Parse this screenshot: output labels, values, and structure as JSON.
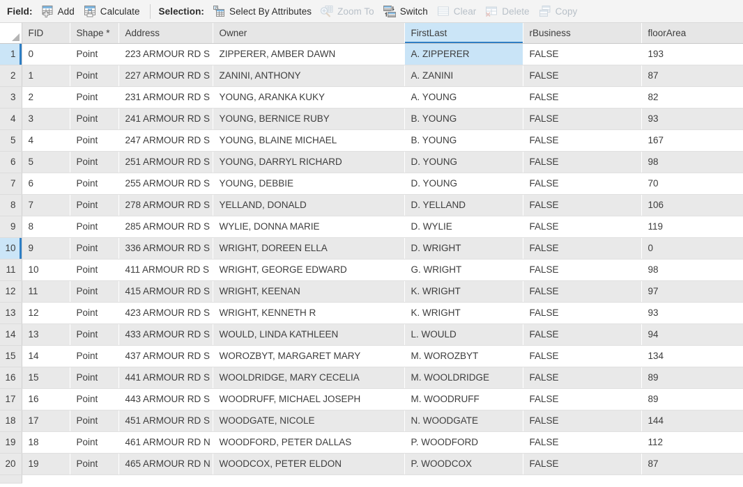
{
  "toolbar": {
    "groups": [
      {
        "name": "field",
        "label": "Field:",
        "buttons": [
          {
            "label": "Add",
            "icon": "table-add-icon",
            "enabled": true
          },
          {
            "label": "Calculate",
            "icon": "table-calculate-icon",
            "enabled": true
          }
        ]
      },
      {
        "name": "selection",
        "label": "Selection:",
        "buttons": [
          {
            "label": "Select By Attributes",
            "icon": "select-by-attributes-icon",
            "enabled": true
          },
          {
            "label": "Zoom To",
            "icon": "zoom-to-icon",
            "enabled": false
          },
          {
            "label": "Switch",
            "icon": "switch-selection-icon",
            "enabled": true
          },
          {
            "label": "Clear",
            "icon": "clear-selection-icon",
            "enabled": false
          },
          {
            "label": "Delete",
            "icon": "delete-selection-icon",
            "enabled": false
          },
          {
            "label": "Copy",
            "icon": "copy-selection-icon",
            "enabled": false
          }
        ]
      }
    ]
  },
  "table": {
    "columns": [
      {
        "key": "rownum",
        "label": "",
        "selected": false
      },
      {
        "key": "fid",
        "label": "FID",
        "selected": false
      },
      {
        "key": "shape",
        "label": "Shape *",
        "selected": false
      },
      {
        "key": "address",
        "label": "Address",
        "selected": false
      },
      {
        "key": "owner",
        "label": "Owner",
        "selected": false
      },
      {
        "key": "first",
        "label": "FirstLast",
        "selected": true
      },
      {
        "key": "rbus",
        "label": "rBusiness",
        "selected": false
      },
      {
        "key": "floor",
        "label": "floorArea",
        "selected": false
      }
    ],
    "selected_column": "FirstLast",
    "active_cell": {
      "row": 1,
      "column": "FirstLast"
    },
    "highlighted_rownums": [
      1,
      10
    ],
    "rows": [
      {
        "rownum": "1",
        "fid": "0",
        "shape": "Point",
        "address": "223 ARMOUR RD S",
        "owner": "ZIPPERER, AMBER DAWN",
        "first": "A. ZIPPERER",
        "rbus": "FALSE",
        "floor": "193"
      },
      {
        "rownum": "2",
        "fid": "1",
        "shape": "Point",
        "address": "227 ARMOUR RD S",
        "owner": "ZANINI, ANTHONY",
        "first": "A. ZANINI",
        "rbus": "FALSE",
        "floor": "87"
      },
      {
        "rownum": "3",
        "fid": "2",
        "shape": "Point",
        "address": "231 ARMOUR RD S",
        "owner": "YOUNG, ARANKA KUKY",
        "first": "A. YOUNG",
        "rbus": "FALSE",
        "floor": "82"
      },
      {
        "rownum": "4",
        "fid": "3",
        "shape": "Point",
        "address": "241 ARMOUR RD S",
        "owner": "YOUNG, BERNICE RUBY",
        "first": "B. YOUNG",
        "rbus": "FALSE",
        "floor": "93"
      },
      {
        "rownum": "5",
        "fid": "4",
        "shape": "Point",
        "address": "247 ARMOUR RD S",
        "owner": "YOUNG, BLAINE MICHAEL",
        "first": "B. YOUNG",
        "rbus": "FALSE",
        "floor": "167"
      },
      {
        "rownum": "6",
        "fid": "5",
        "shape": "Point",
        "address": "251 ARMOUR RD S",
        "owner": "YOUNG, DARRYL RICHARD",
        "first": "D. YOUNG",
        "rbus": "FALSE",
        "floor": "98"
      },
      {
        "rownum": "7",
        "fid": "6",
        "shape": "Point",
        "address": "255 ARMOUR RD S",
        "owner": "YOUNG, DEBBIE",
        "first": "D. YOUNG",
        "rbus": "FALSE",
        "floor": "70"
      },
      {
        "rownum": "8",
        "fid": "7",
        "shape": "Point",
        "address": "278 ARMOUR RD S",
        "owner": "YELLAND, DONALD",
        "first": "D. YELLAND",
        "rbus": "FALSE",
        "floor": "106"
      },
      {
        "rownum": "9",
        "fid": "8",
        "shape": "Point",
        "address": "285 ARMOUR RD S",
        "owner": "WYLIE, DONNA MARIE",
        "first": "D. WYLIE",
        "rbus": "FALSE",
        "floor": "119"
      },
      {
        "rownum": "10",
        "fid": "9",
        "shape": "Point",
        "address": "336 ARMOUR RD S",
        "owner": "WRIGHT, DOREEN ELLA",
        "first": "D. WRIGHT",
        "rbus": "FALSE",
        "floor": "0"
      },
      {
        "rownum": "11",
        "fid": "10",
        "shape": "Point",
        "address": "411 ARMOUR RD S",
        "owner": "WRIGHT, GEORGE EDWARD",
        "first": "G. WRIGHT",
        "rbus": "FALSE",
        "floor": "98"
      },
      {
        "rownum": "12",
        "fid": "11",
        "shape": "Point",
        "address": "415 ARMOUR RD S",
        "owner": "WRIGHT, KEENAN",
        "first": "K. WRIGHT",
        "rbus": "FALSE",
        "floor": "97"
      },
      {
        "rownum": "13",
        "fid": "12",
        "shape": "Point",
        "address": "423 ARMOUR RD S",
        "owner": "WRIGHT, KENNETH R",
        "first": "K. WRIGHT",
        "rbus": "FALSE",
        "floor": "93"
      },
      {
        "rownum": "14",
        "fid": "13",
        "shape": "Point",
        "address": "433 ARMOUR RD S",
        "owner": "WOULD, LINDA KATHLEEN",
        "first": "L. WOULD",
        "rbus": "FALSE",
        "floor": "94"
      },
      {
        "rownum": "15",
        "fid": "14",
        "shape": "Point",
        "address": "437 ARMOUR RD S",
        "owner": "WOROZBYT, MARGARET MARY",
        "first": "M. WOROZBYT",
        "rbus": "FALSE",
        "floor": "134"
      },
      {
        "rownum": "16",
        "fid": "15",
        "shape": "Point",
        "address": "441 ARMOUR RD S",
        "owner": "WOOLDRIDGE, MARY  CECELIA",
        "first": "M. WOOLDRIDGE",
        "rbus": "FALSE",
        "floor": "89"
      },
      {
        "rownum": "17",
        "fid": "16",
        "shape": "Point",
        "address": "443 ARMOUR RD S",
        "owner": "WOODRUFF, MICHAEL JOSEPH",
        "first": "M. WOODRUFF",
        "rbus": "FALSE",
        "floor": "89"
      },
      {
        "rownum": "18",
        "fid": "17",
        "shape": "Point",
        "address": "451 ARMOUR RD S",
        "owner": "WOODGATE, NICOLE",
        "first": "N. WOODGATE",
        "rbus": "FALSE",
        "floor": "144"
      },
      {
        "rownum": "19",
        "fid": "18",
        "shape": "Point",
        "address": "461 ARMOUR RD N",
        "owner": "WOODFORD, PETER DALLAS",
        "first": "P. WOODFORD",
        "rbus": "FALSE",
        "floor": "112"
      },
      {
        "rownum": "20",
        "fid": "19",
        "shape": "Point",
        "address": "465 ARMOUR RD N",
        "owner": "WOODCOX, PETER ELDON",
        "first": "P. WOODCOX",
        "rbus": "FALSE",
        "floor": "87"
      }
    ]
  },
  "colors": {
    "selection_blue": "#cbe5f7",
    "accent_blue": "#2e7ec4",
    "header_gray": "#e6e6e6",
    "row_alt_gray": "#e9e9e9",
    "toolbar_bg": "#f4f4f4",
    "disabled_text": "#b8c0c8"
  }
}
